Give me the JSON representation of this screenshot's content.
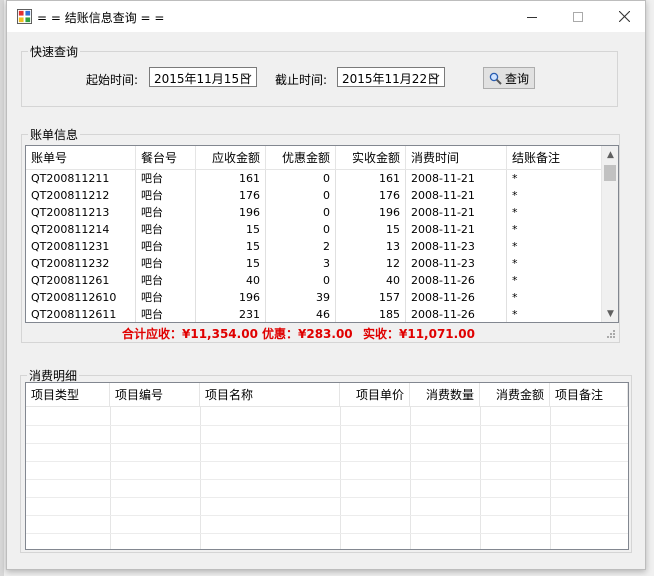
{
  "window": {
    "title": "= = 结账信息查询 = ="
  },
  "quick_query": {
    "group_title": "快速查询",
    "start_label": "起始时间:",
    "start_value": "2015年11月15日",
    "end_label": "截止时间:",
    "end_value": "2015年11月22日",
    "query_button": "查询"
  },
  "bill_info": {
    "group_title": "账单信息",
    "columns": [
      "账单号",
      "餐台号",
      "应收金额",
      "优惠金额",
      "实收金额",
      "消费时间",
      "结账备注"
    ],
    "rows": [
      [
        "QT200811211",
        "吧台",
        "161",
        "0",
        "161",
        "2008-11-21",
        "*"
      ],
      [
        "QT200811212",
        "吧台",
        "176",
        "0",
        "176",
        "2008-11-21",
        "*"
      ],
      [
        "QT200811213",
        "吧台",
        "196",
        "0",
        "196",
        "2008-11-21",
        "*"
      ],
      [
        "QT200811214",
        "吧台",
        "15",
        "0",
        "15",
        "2008-11-21",
        "*"
      ],
      [
        "QT200811231",
        "吧台",
        "15",
        "2",
        "13",
        "2008-11-23",
        "*"
      ],
      [
        "QT200811232",
        "吧台",
        "15",
        "3",
        "12",
        "2008-11-23",
        "*"
      ],
      [
        "QT200811261",
        "吧台",
        "40",
        "0",
        "40",
        "2008-11-26",
        "*"
      ],
      [
        "QT2008112610",
        "吧台",
        "196",
        "39",
        "157",
        "2008-11-26",
        "*"
      ],
      [
        "QT2008112611",
        "吧台",
        "231",
        "46",
        "185",
        "2008-11-26",
        "*"
      ]
    ],
    "summary": {
      "receivable": "合计应收：¥11,354.00",
      "discount": "优惠：¥283.00",
      "received": "实收：¥11,071.00"
    }
  },
  "consumption_detail": {
    "group_title": "消费明细",
    "columns": [
      "项目类型",
      "项目编号",
      "项目名称",
      "项目单价",
      "消费数量",
      "消费金额",
      "项目备注"
    ]
  },
  "colors": {
    "summary_text": "#e00000",
    "window_bg": "#f0f0f0"
  },
  "icons": {
    "app": "app-icon",
    "query": "magnifier-icon"
  }
}
